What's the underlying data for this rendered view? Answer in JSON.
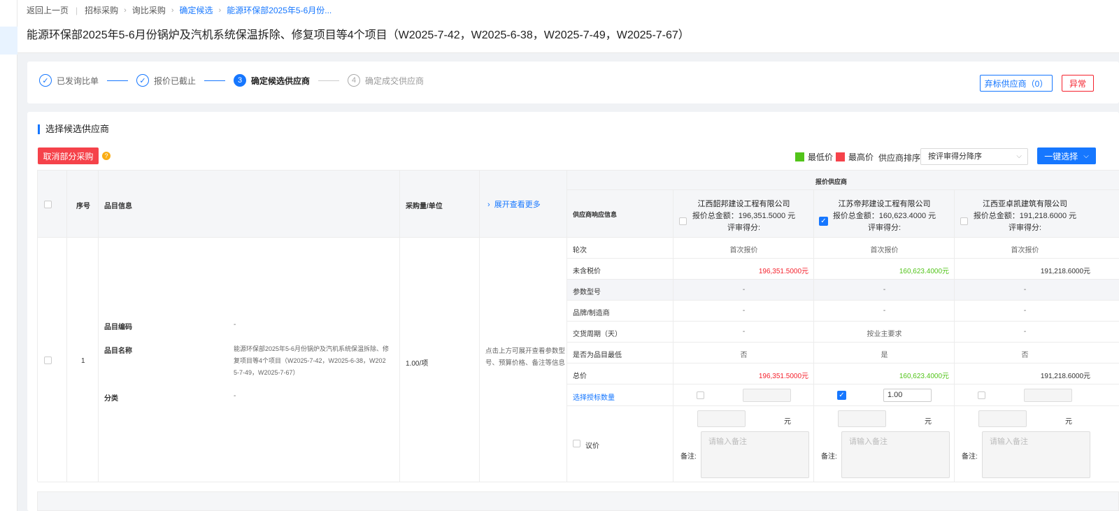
{
  "breadcrumb": {
    "back": "返回上一页",
    "items": [
      "招标采购",
      "询比采购",
      "确定候选"
    ],
    "current": "能源环保部2025年5-6月份..."
  },
  "page_title": "能源环保部2025年5-6月份锅炉及汽机系统保温拆除、修复项目等4个项目（W2025-7-42，W2025-6-38，W2025-7-49，W2025-7-67）",
  "steps": [
    {
      "label": "已发询比单",
      "state": "done",
      "mark": "✓"
    },
    {
      "label": "报价已截止",
      "state": "done",
      "mark": "✓"
    },
    {
      "label": "确定候选供应商",
      "state": "current",
      "mark": "3"
    },
    {
      "label": "确定成交供应商",
      "state": "todo",
      "mark": "4"
    }
  ],
  "buttons": {
    "abandon": "弃标供应商（0）",
    "abnormal": "异常",
    "cancel_partial": "取消部分采购",
    "one_click": "一键选择"
  },
  "section_title": "选择候选供应商",
  "legend": {
    "lowest": "最低价",
    "highest": "最高价",
    "lowest_color": "#52c41a",
    "highest_color": "#f5424a"
  },
  "sort": {
    "label": "供应商排序",
    "value": "按评审得分降序"
  },
  "table": {
    "headers": {
      "index": "序号",
      "item": "品目信息",
      "qty": "采购量/单位",
      "expand": "展开查看更多",
      "quote_suppliers": "报价供应商",
      "response": "供应商响应信息"
    },
    "row": {
      "index": "1",
      "code_label": "品目编码",
      "code_value": "-",
      "name_label": "品目名称",
      "name_value_lines": [
        "能源环保部2025年5-6月份锅炉及汽机系统保温拆除、修",
        "复项目等4个项目（W2025-7-42，W2025-6-38，W202",
        "5-7-49，W2025-7-67）"
      ],
      "category_label": "分类",
      "category_value": "-",
      "qty": "1.00/项",
      "expand_hint_lines": [
        "点击上方可展开查看参数型",
        "号、预算价格、备注等信息"
      ]
    },
    "attr_labels": [
      "轮次",
      "未含税价",
      "参数型号",
      "品牌/制造商",
      "交货周期（天）",
      "是否为品目最低",
      "总价"
    ],
    "select_qty_label": "选择授标数量",
    "negotiate_label": "议价",
    "yuan": "元",
    "remark_label": "备注:",
    "remark_placeholder": "请输入备注",
    "suppliers": [
      {
        "name": "江西韶邦建设工程有限公司",
        "total": "报价总金额：196,351.5000 元",
        "score": "评审得分:",
        "checked": false,
        "round": "首次报价",
        "price_ex_tax": "196,351.5000元",
        "price_color": "red",
        "model": "-",
        "brand": "-",
        "delivery": "-",
        "is_lowest": "否",
        "total_price": "196,351.5000元",
        "award_qty": ""
      },
      {
        "name": "江苏帝邦建设工程有限公司",
        "total": "报价总金额：160,623.4000 元",
        "score": "评审得分:",
        "checked": true,
        "round": "首次报价",
        "price_ex_tax": "160,623.4000元",
        "price_color": "green",
        "model": "-",
        "brand": "-",
        "delivery": "按业主要求",
        "is_lowest": "是",
        "total_price": "160,623.4000元",
        "award_qty": "1.00"
      },
      {
        "name": "江西亚卓凯建筑有限公司",
        "total": "报价总金额：191,218.6000 元",
        "score": "评审得分:",
        "checked": false,
        "round": "首次报价",
        "price_ex_tax": "191,218.6000元",
        "price_color": "black",
        "model": "-",
        "brand": "-",
        "delivery": "-",
        "is_lowest": "否",
        "total_price": "191,218.6000元",
        "award_qty": ""
      }
    ]
  }
}
